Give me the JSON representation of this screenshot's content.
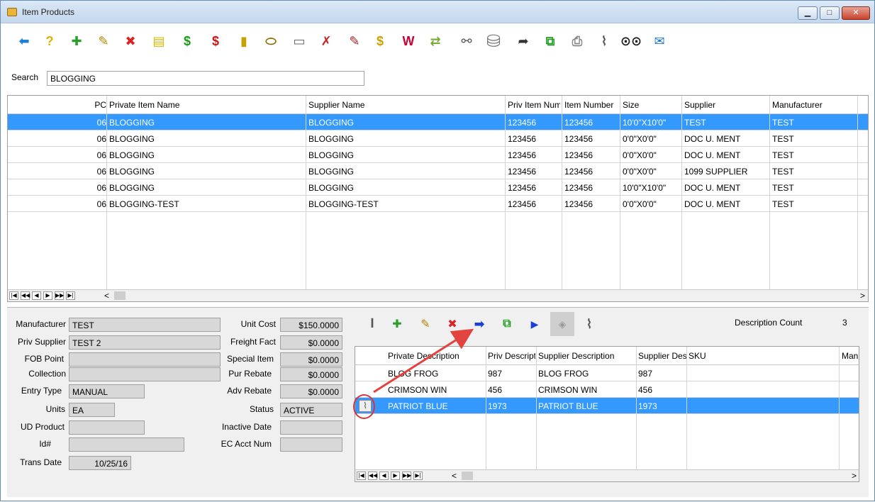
{
  "window": {
    "title": "Item Products",
    "minimize": "▁",
    "maximize": "□",
    "close": "✕"
  },
  "toolbar": {
    "icons": [
      "back-arrow-icon",
      "help-icon",
      "new-item-icon",
      "edit-item-icon",
      "delete-item-icon",
      "note-icon",
      "price-green-icon",
      "price-red-icon",
      "report-icon",
      "tag-icon",
      "tag-list-icon",
      "tag-delete-icon",
      "tag-edit-icon",
      "dollar-tag-icon",
      "web-icon",
      "transfer-icon",
      "link-icon",
      "database-icon",
      "forward-icon",
      "copy-icon",
      "print-icon",
      "attach-icon",
      "binoculars-icon",
      "email-icon"
    ]
  },
  "search": {
    "label": "Search",
    "value": "BLOGGING"
  },
  "items_grid": {
    "columns": [
      "PC",
      "Private Item Name",
      "Supplier Name",
      "Priv Item Num",
      "Item Number",
      "Size",
      "Supplier",
      "Manufacturer"
    ],
    "rows": [
      [
        "06",
        "BLOGGING",
        "BLOGGING",
        "123456",
        "123456",
        "10'0\"X10'0\"",
        "TEST",
        "TEST"
      ],
      [
        "06",
        "BLOGGING",
        "BLOGGING",
        "123456",
        "123456",
        "0'0\"X0'0\"",
        "DOC U. MENT",
        "TEST"
      ],
      [
        "06",
        "BLOGGING",
        "BLOGGING",
        "123456",
        "123456",
        "0'0\"X0'0\"",
        "DOC U. MENT",
        "TEST"
      ],
      [
        "06",
        "BLOGGING",
        "BLOGGING",
        "123456",
        "123456",
        "0'0\"X0'0\"",
        "1099 SUPPLIER",
        "TEST"
      ],
      [
        "06",
        "BLOGGING",
        "BLOGGING",
        "123456",
        "123456",
        "10'0\"X10'0\"",
        "DOC U. MENT",
        "TEST"
      ],
      [
        "06",
        "BLOGGING-TEST",
        "BLOGGING-TEST",
        "123456",
        "123456",
        "0'0\"X0'0\"",
        "DOC U. MENT",
        "TEST"
      ]
    ]
  },
  "details": {
    "manufacturer_label": "Manufacturer",
    "manufacturer": "TEST",
    "priv_supplier_label": "Priv Supplier",
    "priv_supplier": "TEST 2",
    "fob_label": "FOB Point",
    "fob": "",
    "collection_label": "Collection",
    "collection": "",
    "entry_type_label": "Entry Type",
    "entry_type": "MANUAL",
    "units_label": "Units",
    "units": "EA",
    "ud_product_label": "UD Product",
    "ud_product": "",
    "id_label": "Id#",
    "id": "",
    "trans_date_label": "Trans Date",
    "trans_date": "10/25/16",
    "unit_cost_label": "Unit Cost",
    "unit_cost": "$150.0000",
    "freight_label": "Freight Fact",
    "freight": "$0.0000",
    "special_label": "Special Item",
    "special": "$0.0000",
    "pur_rebate_label": "Pur Rebate",
    "pur_rebate": "$0.0000",
    "adv_rebate_label": "Adv Rebate",
    "adv_rebate": "$0.0000",
    "status_label": "Status",
    "status": "ACTIVE",
    "inactive_label": "Inactive Date",
    "inactive": "",
    "ec_acct_label": "EC Acct Num",
    "ec_acct": ""
  },
  "desc": {
    "count_label": "Description Count",
    "count": "3",
    "columns": [
      "Private Description",
      "Priv Descript",
      "Supplier Description",
      "Supplier Des",
      "SKU",
      "Man"
    ],
    "rows": [
      [
        "BLOG FROG",
        "987",
        "BLOG FROG",
        "987",
        "",
        ""
      ],
      [
        "CRIMSON WIN",
        "456",
        "CRIMSON WIN",
        "456",
        "",
        ""
      ],
      [
        "PATRIOT BLUE",
        "1973",
        "PATRIOT BLUE",
        "1973",
        "",
        ""
      ]
    ]
  },
  "nav": {
    "first": "|◀",
    "prev_page": "◀◀",
    "prev": "◀",
    "next": "▶",
    "next_page": "▶▶",
    "last": "▶|",
    "scroll_left": "<",
    "scroll_right": ">"
  }
}
